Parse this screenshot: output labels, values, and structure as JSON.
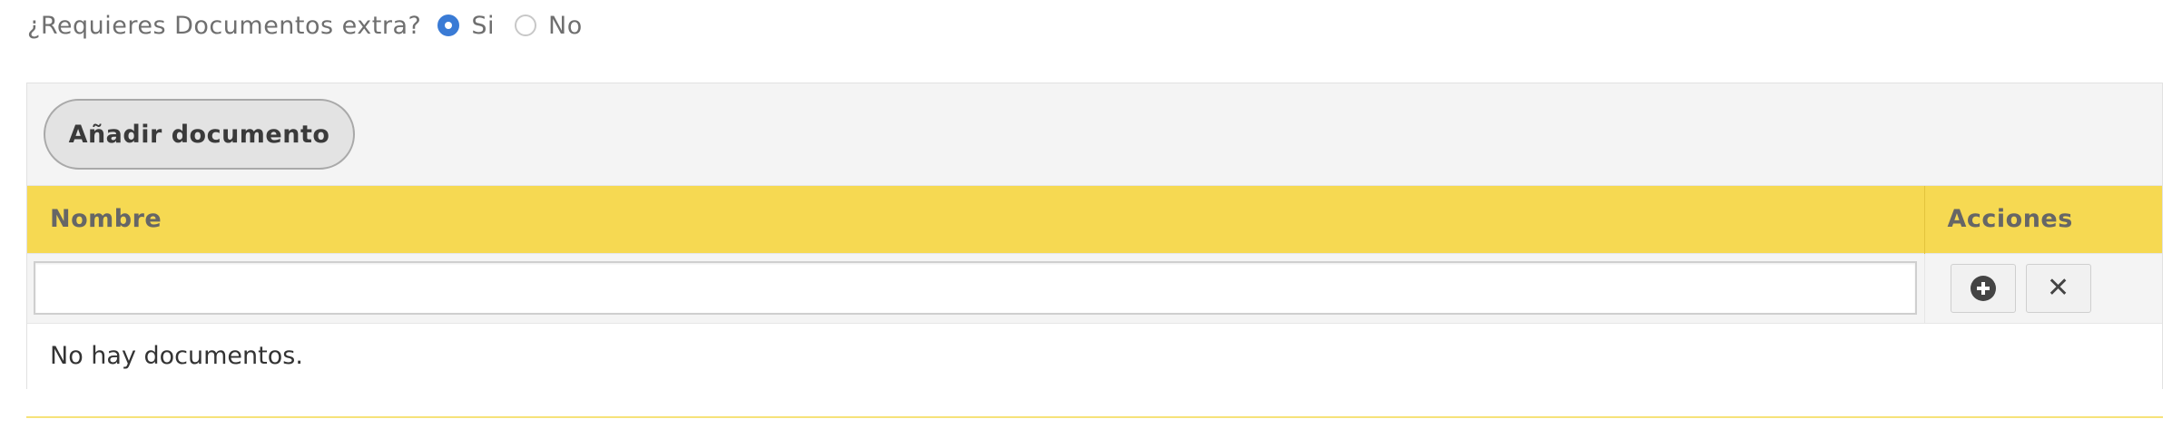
{
  "question": {
    "label": "¿Requieres Documentos extra?",
    "options": [
      {
        "label": "Si",
        "checked": true
      },
      {
        "label": "No",
        "checked": false
      }
    ]
  },
  "toolbar": {
    "add_document_label": "Añadir documento"
  },
  "table": {
    "columns": [
      "Nombre",
      "Acciones"
    ],
    "name_input_value": "",
    "empty_message": "No hay documentos."
  },
  "icons": {
    "add": "plus-circle-icon",
    "remove": "close-icon"
  },
  "colors": {
    "header_bg": "#f6d952",
    "radio_accent": "#3a7bd5",
    "toolbar_bg": "#f4f4f4"
  }
}
